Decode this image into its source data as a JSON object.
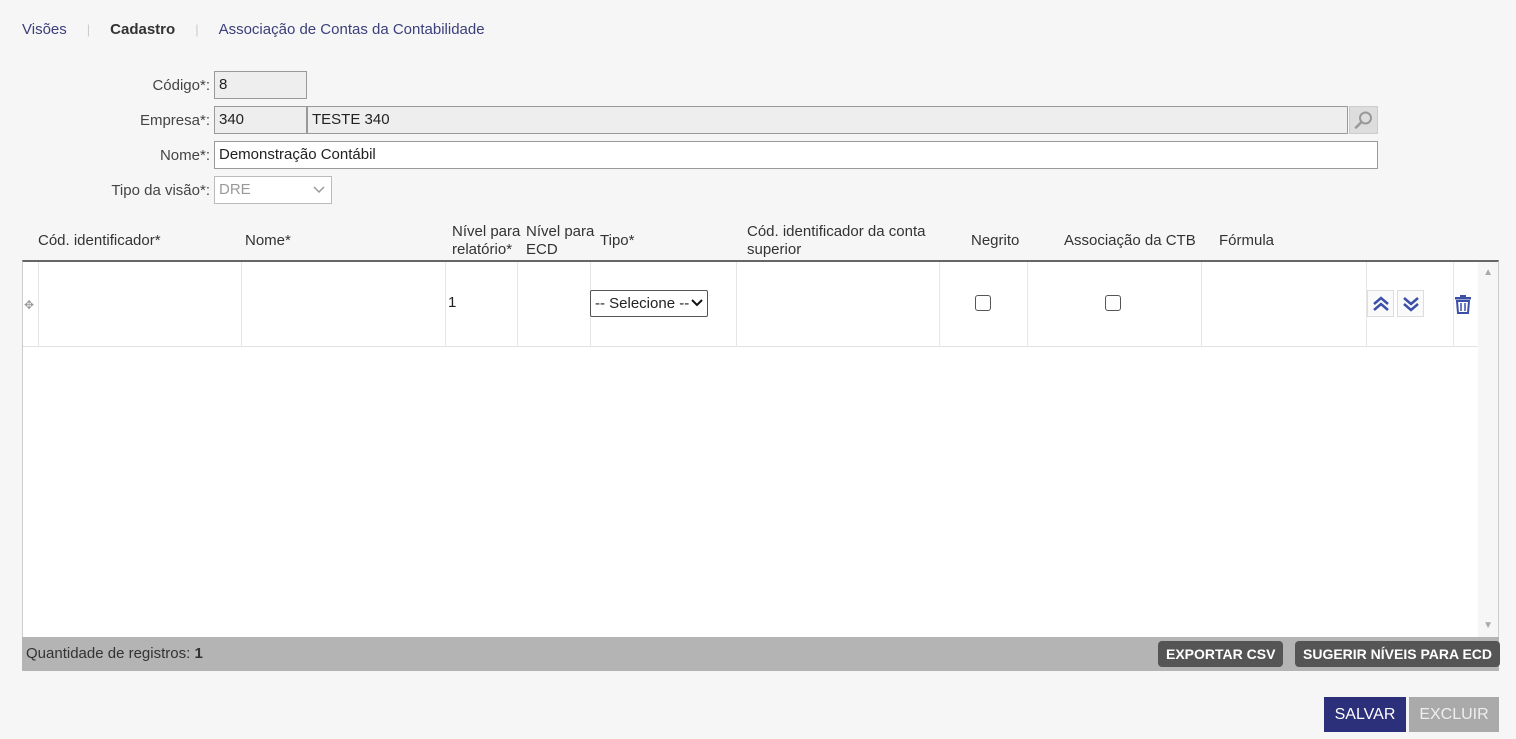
{
  "breadcrumb": {
    "items": [
      "Visões",
      "Cadastro",
      "Associação de Contas da Contabilidade"
    ]
  },
  "form": {
    "codigo_label": "Código*:",
    "codigo_value": "8",
    "empresa_label": "Empresa*:",
    "empresa_code": "340",
    "empresa_name": "TESTE 340",
    "nome_label": "Nome*:",
    "nome_value": "Demonstração Contábil",
    "tipo_label": "Tipo da visão*:",
    "tipo_value": "DRE"
  },
  "table": {
    "headers": {
      "cod": "Cód. identificador*",
      "nome": "Nome*",
      "nivel_rel_1": "Nível para",
      "nivel_rel_2": "relatório*",
      "nivel_ecd_1": "Nível para",
      "nivel_ecd_2": "ECD",
      "tipo": "Tipo*",
      "cod_sup_1": "Cód. identificador da conta",
      "cod_sup_2": "superior",
      "negrito": "Negrito",
      "assoc": "Associação da CTB",
      "formula": "Fórmula"
    },
    "rows": [
      {
        "cod": "",
        "nome": "",
        "nivel_relatorio": "1",
        "nivel_ecd": "",
        "tipo": "-- Selecione --",
        "cod_superior": "",
        "negrito": false,
        "associacao": false,
        "formula": ""
      }
    ]
  },
  "footer": {
    "count_label": "Quantidade de registros:",
    "count_value": "1",
    "export_btn": "EXPORTAR CSV",
    "suggest_btn": "SUGERIR NÍVEIS PARA ECD"
  },
  "actions": {
    "save": "SALVAR",
    "delete": "EXCLUIR"
  },
  "colors": {
    "primary": "#2c2f7a",
    "link": "#3b3f7a",
    "icon_blue": "#3b4fa8"
  }
}
